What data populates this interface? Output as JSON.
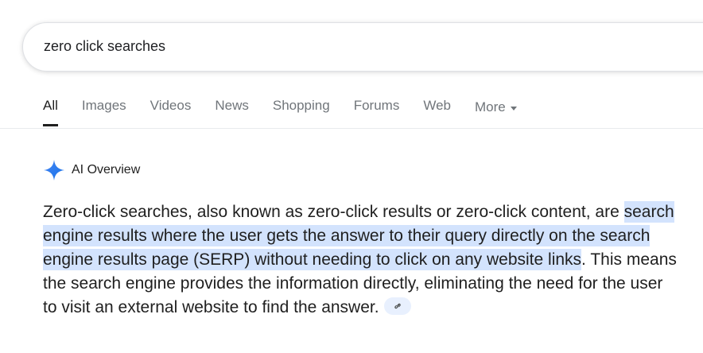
{
  "search": {
    "query": "zero click searches"
  },
  "tabs": [
    {
      "label": "All",
      "active": true
    },
    {
      "label": "Images",
      "active": false
    },
    {
      "label": "Videos",
      "active": false
    },
    {
      "label": "News",
      "active": false
    },
    {
      "label": "Shopping",
      "active": false
    },
    {
      "label": "Forums",
      "active": false
    },
    {
      "label": "Web",
      "active": false
    },
    {
      "label": "More",
      "active": false
    }
  ],
  "ai_overview": {
    "heading": "AI Overview",
    "icon": "sparkle-icon",
    "text_before": "Zero-click searches, also known as zero-click results or zero-click content, are ",
    "text_highlighted": "search engine results where the user gets the answer to their query directly on the search engine results page (SERP) without needing to click on any website links",
    "text_after": ". This means the search engine provides the information directly, eliminating the need for the user to visit an external website to find the answer.",
    "link_icon": "link-icon"
  },
  "colors": {
    "highlight": "#d3e3fd",
    "sparkle": "#4285f4",
    "tab_inactive": "#70757a",
    "link_chip": "#e8f0fe"
  }
}
